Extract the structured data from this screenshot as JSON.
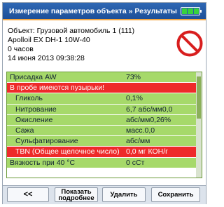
{
  "titlebar": {
    "title": "Измерение параметров объекта » Результаты"
  },
  "info": {
    "line1": "Объект: Грузовой автомобиль 1 (111)",
    "line2": "Apolloil EX DH-1 10W-40",
    "line3": "0 часов",
    "line4": "14 июня 2013 09:38:28"
  },
  "results": [
    {
      "label": "Присадка AW",
      "value": "73%"
    },
    {
      "label": "В пробе имеются пузырьки!",
      "value": ""
    },
    {
      "label": "Гликоль",
      "value": "0,1%"
    },
    {
      "label": "Нитрование",
      "value": "6,7 абс/мм0,0"
    },
    {
      "label": "Окисление",
      "value": "абс/мм0,26%"
    },
    {
      "label": "Сажа",
      "value": "масс.0,0"
    },
    {
      "label": "Сульфатирование",
      "value": "абс/мм"
    },
    {
      "label": "TBN (Общее щелочное число)",
      "value": "0,0 мг КОН/г"
    },
    {
      "label": "Вязкость при 40 °C",
      "value": "0 сСт"
    }
  ],
  "buttons": {
    "back": "<<",
    "more_1": "Показать",
    "more_2": "подробнее",
    "delete": "Удалить",
    "save": "Сохранить"
  },
  "colors": {
    "ok_row": "#a6d96a",
    "alert_row": "#ee2a2a",
    "titlebar": "#2f68b4"
  },
  "icons": {
    "status": "prohibited-icon",
    "battery": "battery-icon"
  }
}
